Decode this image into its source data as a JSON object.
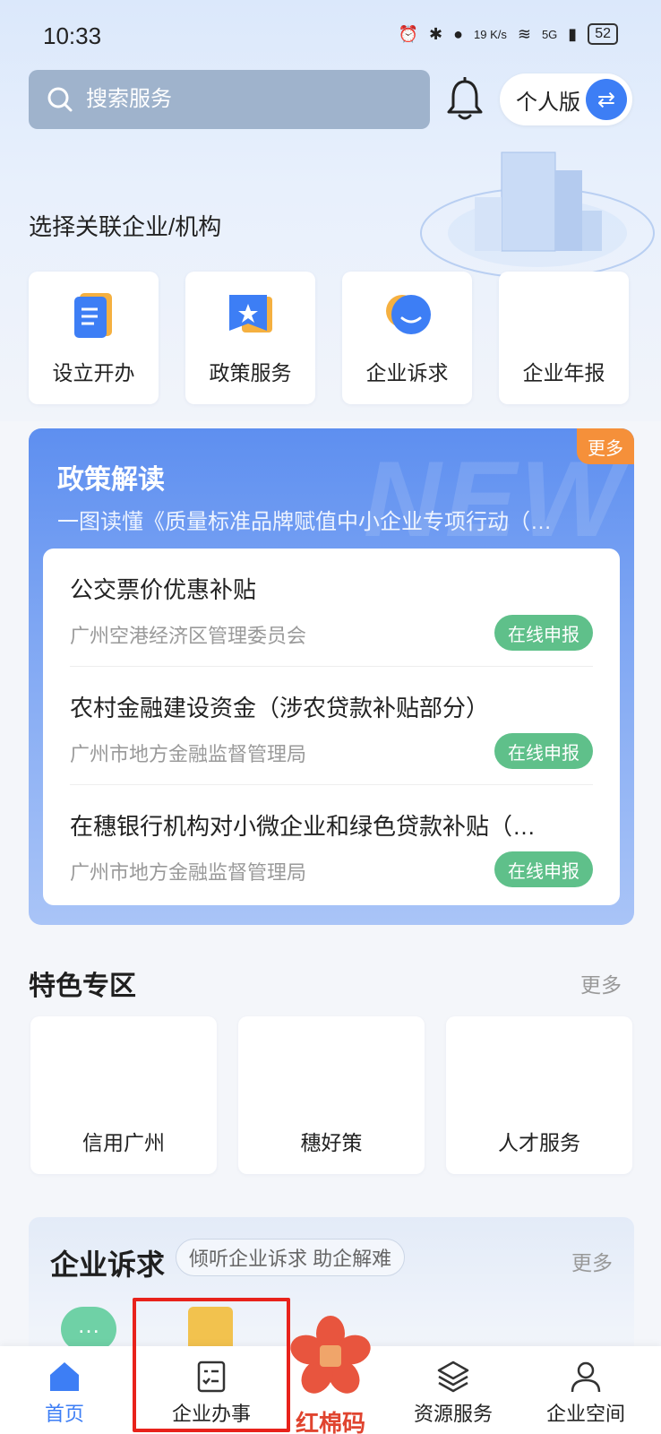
{
  "status_bar": {
    "time": "10:33",
    "net_speed": "19 K/s",
    "network": "5G",
    "battery": "52"
  },
  "header": {
    "search_placeholder": "搜索服务",
    "version_label": "个人版",
    "icons": [
      "search-icon",
      "bell-icon",
      "swap-icon"
    ]
  },
  "org_select_label": "选择关联企业/机构",
  "quick_entries": [
    {
      "label": "设立开办",
      "icon": "document-icon"
    },
    {
      "label": "政策服务",
      "icon": "badge-star-icon"
    },
    {
      "label": "企业诉求",
      "icon": "chat-bubble-icon"
    },
    {
      "label": "企业年报",
      "icon": "report-icon"
    }
  ],
  "policy": {
    "title": "政策解读",
    "more": "更多",
    "watermark": "NEW",
    "subtitle": "一图读懂《质量标准品牌赋值中小企业专项行动（…",
    "items": [
      {
        "title": "公交票价优惠补贴",
        "org": "广州空港经济区管理委员会",
        "action": "在线申报"
      },
      {
        "title": "农村金融建设资金（涉农贷款补贴部分）",
        "org": "广州市地方金融监督管理局",
        "action": "在线申报"
      },
      {
        "title": "在穗银行机构对小微企业和绿色贷款补贴（…",
        "org": "广州市地方金融监督管理局",
        "action": "在线申报"
      }
    ]
  },
  "featured": {
    "title": "特色专区",
    "more": "更多",
    "items": [
      "信用广州",
      "穗好策",
      "人才服务"
    ]
  },
  "appeal": {
    "title": "企业诉求",
    "pill": "倾听企业诉求 助企解难",
    "more": "更多",
    "bubble": "…"
  },
  "tabbar": {
    "tabs": [
      {
        "label": "首页",
        "icon": "home-icon",
        "active": true
      },
      {
        "label": "企业办事",
        "icon": "checklist-icon",
        "active": false
      },
      {
        "label": "红棉码",
        "icon": "kapok-flower-icon",
        "active": false
      },
      {
        "label": "资源服务",
        "icon": "layers-icon",
        "active": false
      },
      {
        "label": "企业空间",
        "icon": "user-icon",
        "active": false
      }
    ]
  },
  "colors": {
    "accent": "#3d7ef5",
    "green_button": "#5fc08a",
    "orange_tag": "#f5903a",
    "highlight_border": "#e8221b",
    "kapok_red": "#e0442f"
  }
}
